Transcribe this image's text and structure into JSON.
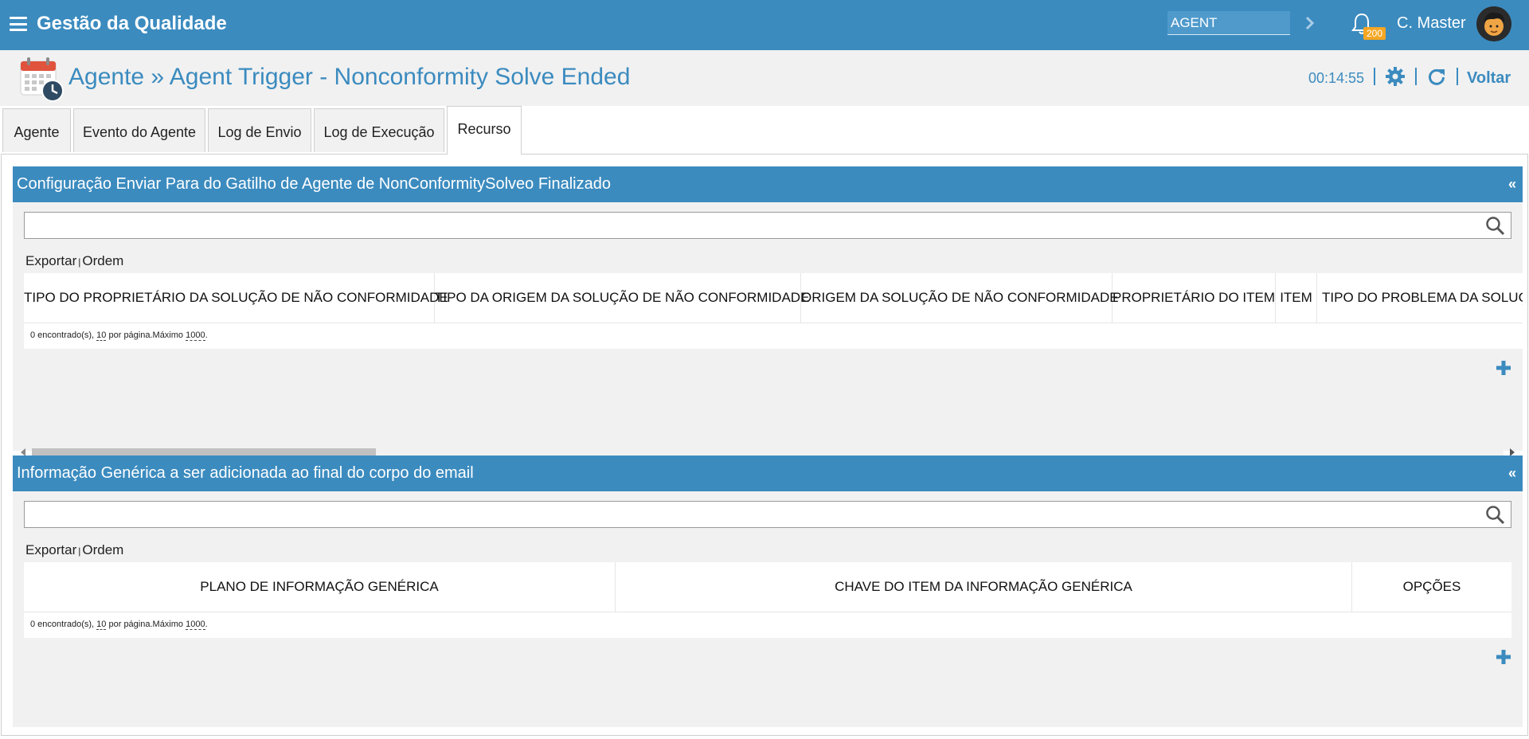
{
  "app": {
    "title": "Gestão da Qualidade"
  },
  "topbar": {
    "module_value": "AGENT",
    "notification_count": "200",
    "user_name": "C. Master"
  },
  "header": {
    "title": "Agente » Agent Trigger - Nonconformity Solve Ended",
    "timer": "00:14:55",
    "back_label": "Voltar"
  },
  "tabs": [
    {
      "label": "Agente",
      "active": false
    },
    {
      "label": "Evento do Agente",
      "active": false
    },
    {
      "label": "Log de Envio",
      "active": false
    },
    {
      "label": "Log de Execução",
      "active": false
    },
    {
      "label": "Recurso",
      "active": true
    }
  ],
  "panel1": {
    "title": "Configuração Enviar Para do Gatilho de Agente de NonConformitySolveo Finalizado",
    "collapse": "«",
    "search_value": "",
    "export_label": "Exportar",
    "order_label": "Ordem",
    "columns": [
      "TIPO DO PROPRIETÁRIO DA SOLUÇÃO DE NÃO CONFORMIDADE",
      "TIPO DA ORIGEM DA SOLUÇÃO DE NÃO CONFORMIDADE",
      "ORIGEM DA SOLUÇÃO DE NÃO CONFORMIDADE",
      "PROPRIETÁRIO DO ITEM",
      "ITEM",
      "TIPO DO PROBLEMA DA SOLUÇÃO"
    ],
    "footer": {
      "found": "0 encontrado(s),",
      "per_page": "10",
      "per_page_text": "por página.Máximo",
      "max": "1000",
      "end": "."
    }
  },
  "panel2": {
    "title": "Informação Genérica a ser adicionada ao final do corpo do email",
    "collapse": "«",
    "search_value": "",
    "export_label": "Exportar",
    "order_label": "Ordem",
    "columns": [
      "PLANO DE INFORMAÇÃO GENÉRICA",
      "CHAVE DO ITEM DA INFORMAÇÃO GENÉRICA",
      "OPÇÕES"
    ],
    "footer": {
      "found": "0 encontrado(s),",
      "per_page": "10",
      "per_page_text": "por página.Máximo",
      "max": "1000",
      "end": "."
    }
  },
  "colors": {
    "brand": "#3b8bbf",
    "badge": "#f5a623",
    "panel_bg": "#f1f1f1"
  },
  "icons": [
    "menu-icon",
    "chevron-right-icon",
    "bell-icon",
    "calendar-clock-icon",
    "gear-icon",
    "refresh-icon",
    "search-icon",
    "plus-icon"
  ]
}
